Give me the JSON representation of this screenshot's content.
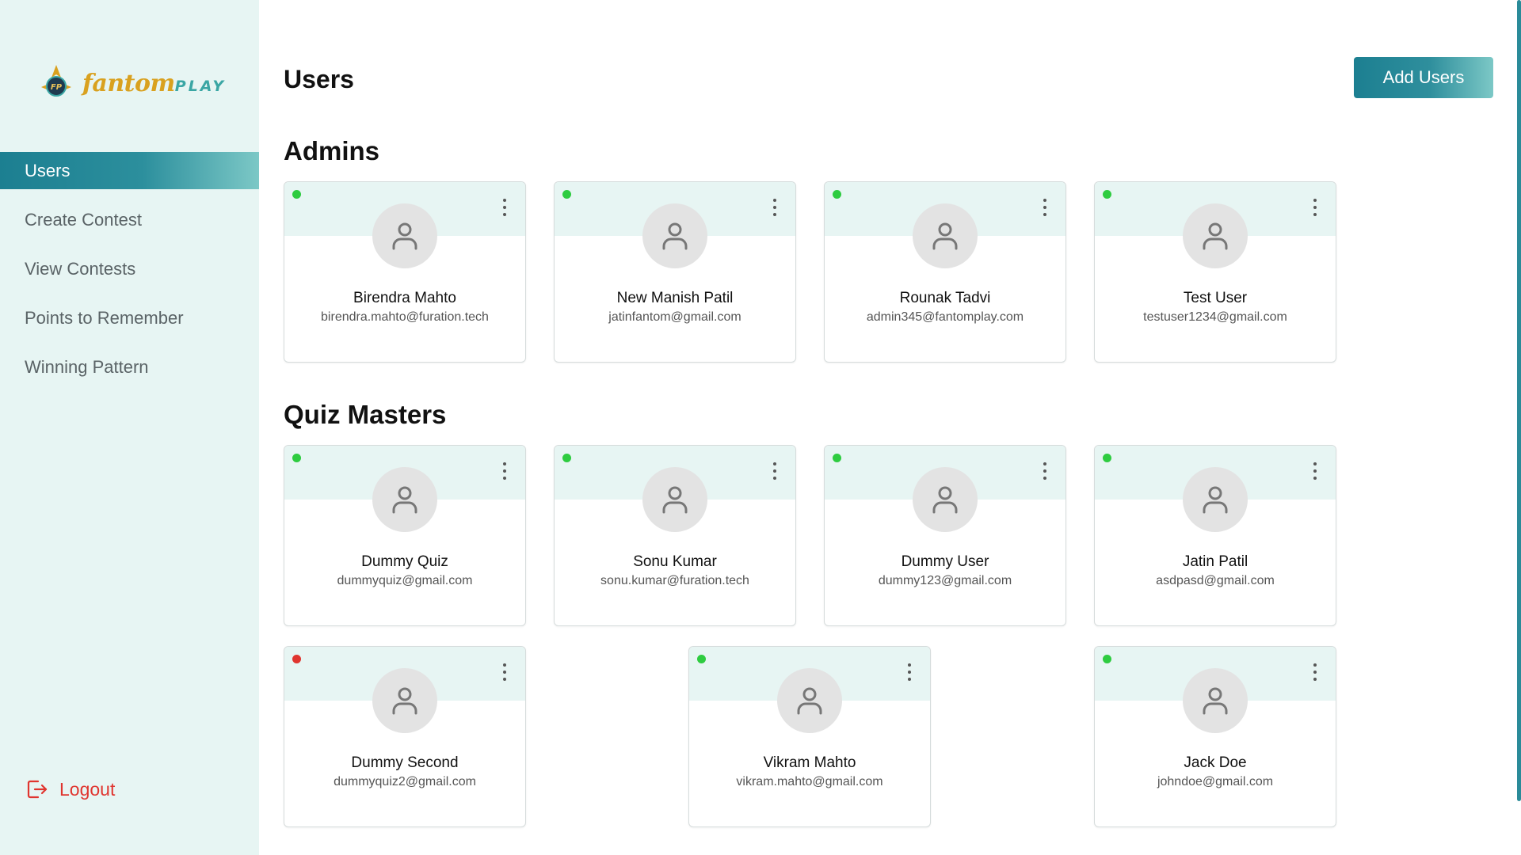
{
  "brand": {
    "name_main": "fantom",
    "name_sub": "PLAY",
    "accent": "#2a8b99",
    "gold": "#d9a11f"
  },
  "sidebar": {
    "items": [
      {
        "label": "Users",
        "active": true
      },
      {
        "label": "Create Contest",
        "active": false
      },
      {
        "label": "View Contests",
        "active": false
      },
      {
        "label": "Points to Remember",
        "active": false
      },
      {
        "label": "Winning Pattern",
        "active": false
      }
    ],
    "logout_label": "Logout"
  },
  "header": {
    "title": "Users",
    "add_button_label": "Add Users"
  },
  "status_colors": {
    "active": "#2ecc40",
    "inactive": "#e0352f"
  },
  "admins": {
    "title": "Admins",
    "users": [
      {
        "name": "Birendra Mahto",
        "email": "birendra.mahto@furation.tech",
        "status": "active"
      },
      {
        "name": "New Manish Patil",
        "email": "jatinfantom@gmail.com",
        "status": "active"
      },
      {
        "name": "Rounak Tadvi",
        "email": "admin345@fantomplay.com",
        "status": "active"
      },
      {
        "name": "Test User",
        "email": "testuser1234@gmail.com",
        "status": "active"
      }
    ]
  },
  "quiz_masters": {
    "title": "Quiz Masters",
    "users": [
      {
        "name": "Dummy Quiz",
        "email": "dummyquiz@gmail.com",
        "status": "active"
      },
      {
        "name": "Sonu Kumar",
        "email": "sonu.kumar@furation.tech",
        "status": "active"
      },
      {
        "name": "Dummy User",
        "email": "dummy123@gmail.com",
        "status": "active"
      },
      {
        "name": "Jatin Patil",
        "email": "asdpasd@gmail.com",
        "status": "active"
      },
      {
        "name": "Dummy Second",
        "email": "dummyquiz2@gmail.com",
        "status": "inactive"
      },
      {
        "name": "Vikram Mahto",
        "email": "vikram.mahto@gmail.com",
        "status": "active"
      },
      {
        "name": "Jack Doe",
        "email": "johndoe@gmail.com",
        "status": "active"
      }
    ]
  }
}
